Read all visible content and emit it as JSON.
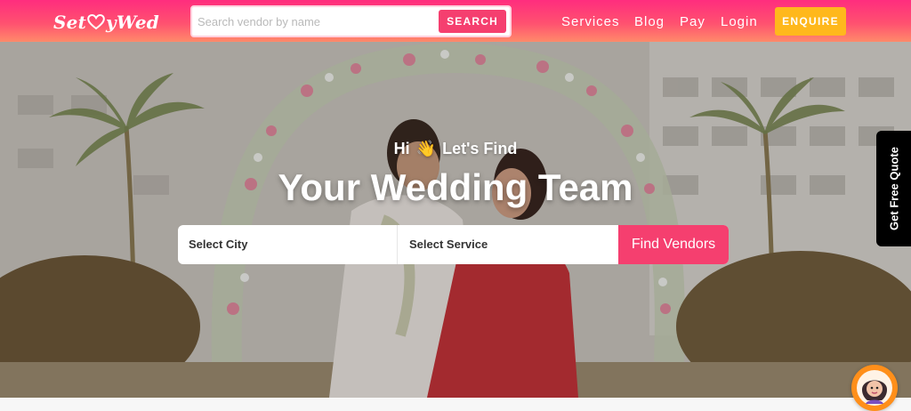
{
  "header": {
    "logo_text_left": "Set",
    "logo_text_right": "yWed",
    "search": {
      "placeholder": "Search vendor by name",
      "button_label": "SEARCH"
    },
    "nav": [
      "Services",
      "Blog",
      "Pay",
      "Login"
    ],
    "enquire_label": "ENQUIRE"
  },
  "hero": {
    "greeting_pre": "Hi",
    "greeting_emoji": "👋",
    "greeting_post": "Let's Find",
    "headline": "Your Wedding Team",
    "city_select": "Select City",
    "service_select": "Select Service",
    "find_button": "Find Vendors"
  },
  "side_tab": {
    "label": "Get Free Quote"
  },
  "icons": [
    "heart-icon",
    "wave-hand-icon",
    "chat-avatar-icon"
  ],
  "colors": {
    "brand_pink": "#f53f6f",
    "enquire_yellow": "#ffb81c",
    "tab_black": "#000000"
  }
}
